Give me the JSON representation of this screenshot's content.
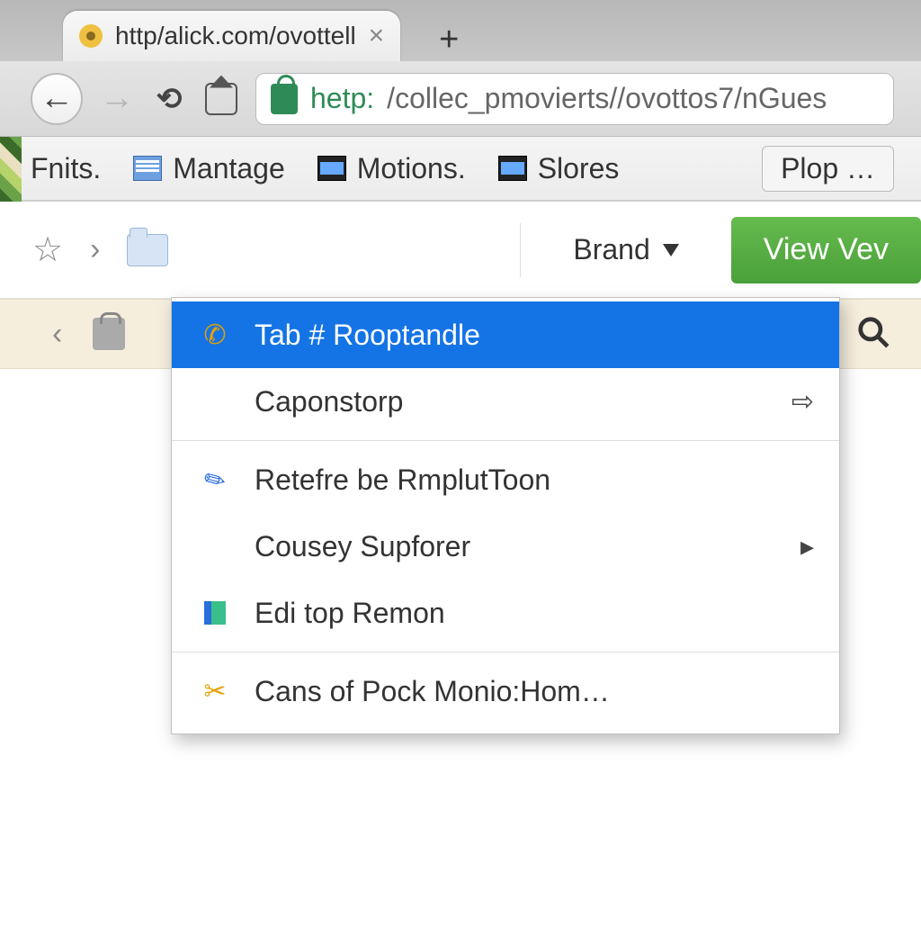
{
  "tab": {
    "title": "http/alick.com/ovottell",
    "close_glyph": "×",
    "newtab_glyph": "+"
  },
  "nav": {
    "back_glyph": "←",
    "forward_glyph": "→",
    "reload_glyph": "⟲"
  },
  "address": {
    "protocol": "hetp:",
    "rest": "/collec_pmovierts//ovottos7/nGues"
  },
  "bookmarks": {
    "items": [
      {
        "label": "Fnits."
      },
      {
        "label": "Mantage"
      },
      {
        "label": "Motions."
      },
      {
        "label": "Slores"
      }
    ],
    "overflow_label": "Plop …"
  },
  "page_strip": {
    "star_glyph": "☆",
    "chevron_glyph": "›",
    "brand_label": "Brand",
    "view_button_label": "View Vev"
  },
  "beige_row": {
    "back_glyph": "‹"
  },
  "context_menu": {
    "items": [
      {
        "label": "Tab # Rooptandle",
        "highlighted": true,
        "icon": "phone"
      },
      {
        "label": "Caponstorp",
        "submenu": true,
        "arrow_glyph": "⇨"
      },
      {
        "sep": true
      },
      {
        "label": "Retefre be RmplutToon",
        "icon": "pen"
      },
      {
        "label": "Cousey Supforer",
        "submenu": true,
        "arrow_glyph": "▸"
      },
      {
        "label": "Edi top Remon",
        "icon": "flag"
      },
      {
        "sep": true
      },
      {
        "label": "Cans of Pock Monio:Hom…",
        "icon": "cut"
      }
    ]
  }
}
